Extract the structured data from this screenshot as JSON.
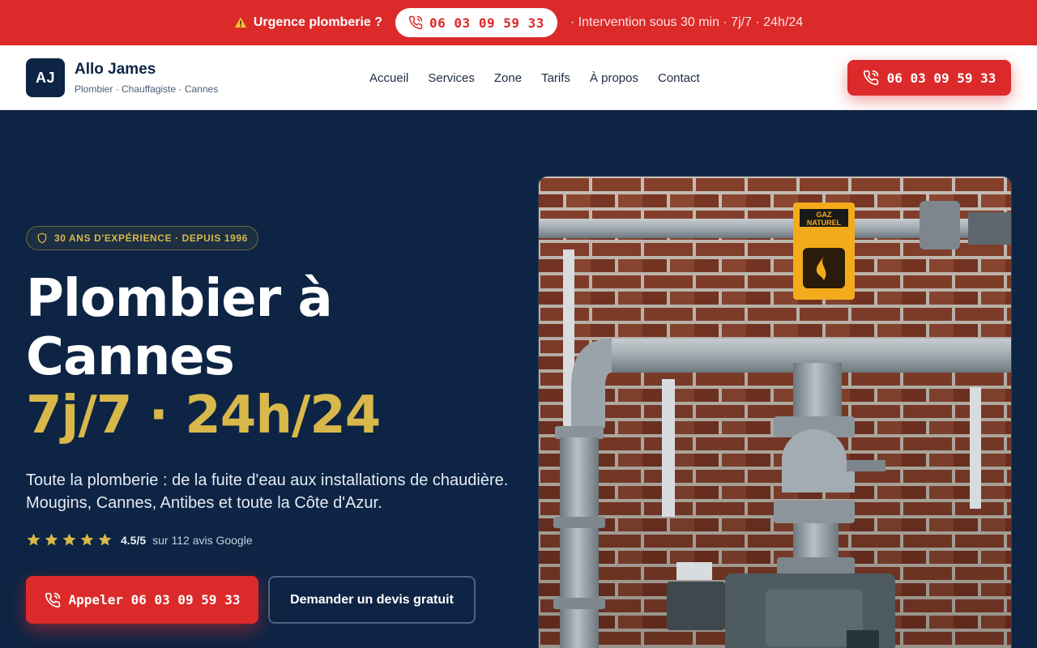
{
  "topbar": {
    "urgency_label": "Urgence plomberie ?",
    "phone": "06 03 09 59 33",
    "info": "· Intervention sous 30 min · 7j/7 · 24h/24"
  },
  "header": {
    "logo_initials": "AJ",
    "brand_name": "Allo James",
    "brand_tagline": "Plombier · Chauffagiste · Cannes",
    "nav": [
      "Accueil",
      "Services",
      "Zone",
      "Tarifs",
      "À propos",
      "Contact"
    ],
    "call_phone": "06 03 09 59 33"
  },
  "hero": {
    "badge": "30 ANS D'EXPÉRIENCE · DEPUIS 1996",
    "title_line1": "Plombier à",
    "title_line2": "Cannes",
    "title_highlight": "7j/7 · 24h/24",
    "lead": "Toute la plomberie : de la fuite d'eau aux installations de chaudière. Mougins, Cannes, Antibes et toute la Côte d'Azur.",
    "rating": {
      "stars": 5,
      "score": "4.5/5",
      "reviews": "sur 112 avis Google"
    },
    "cta_call": "Appeler 06 03 09 59 33",
    "cta_quote": "Demander un devis gratuit",
    "photo_sign": {
      "line1": "GAZ",
      "line2": "NATUREL"
    }
  },
  "colors": {
    "accent_red": "#dc2a2a",
    "navy": "#0d2444",
    "gold": "#d8b84a"
  },
  "icons": [
    "warning-icon",
    "phone-icon",
    "shield-icon",
    "star-icon"
  ]
}
